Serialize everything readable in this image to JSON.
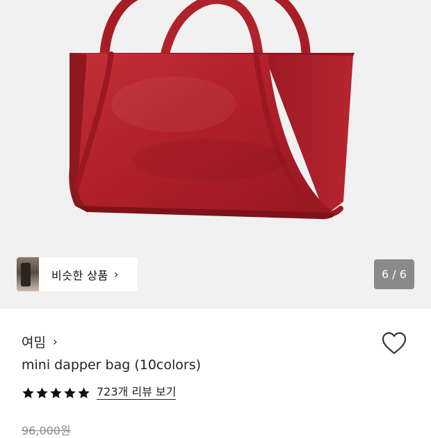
{
  "gallery": {
    "similar_label": "비슷한 상품",
    "similar_chevron": "›",
    "counter": "6 / 6"
  },
  "product": {
    "brand": "여밈",
    "brand_chevron": "›",
    "title": "mini dapper bag (10colors)",
    "rating_stars": 5,
    "review_link": "723개 리뷰 보기",
    "original_price": "96,000원"
  },
  "colors": {
    "bag": "#b4202a",
    "gallery_bg": "#f1f1f1",
    "star": "#111111"
  },
  "icons": [
    "chevron-right-icon",
    "heart-icon",
    "star-icon"
  ]
}
